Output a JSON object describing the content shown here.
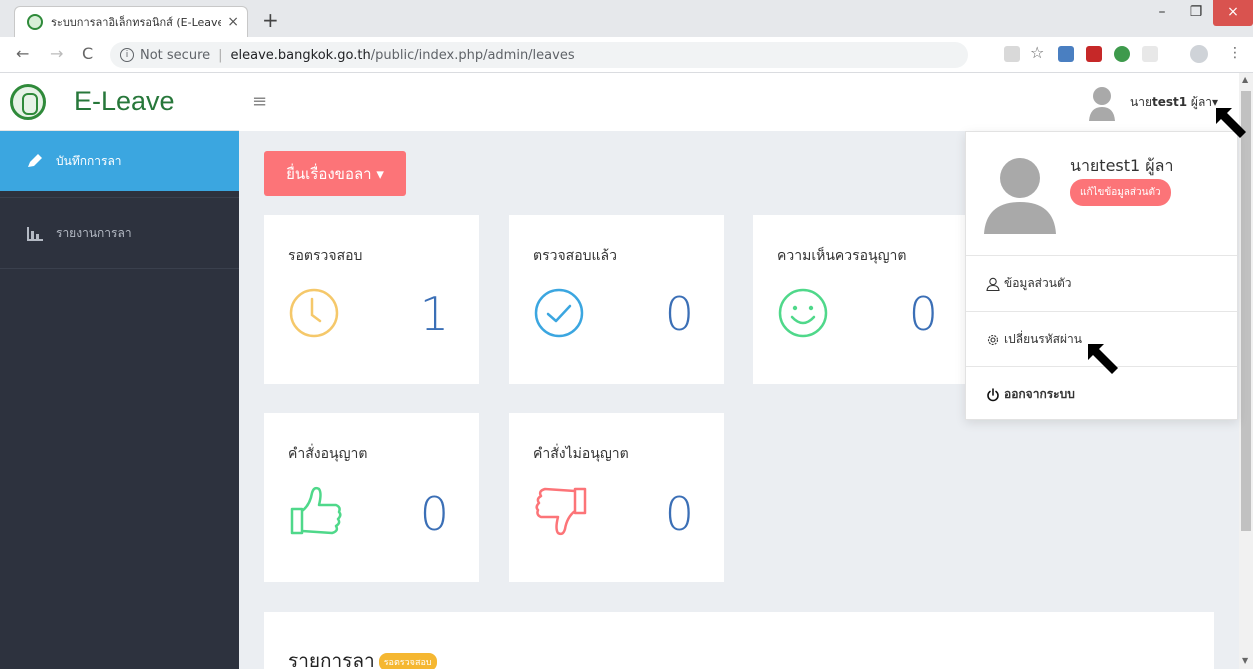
{
  "browser": {
    "tab_title": "ระบบการลาอิเล็กทรอนิกส์ (E-Leave)",
    "tab_close": "×",
    "new_tab": "+",
    "security_label": "Not secure",
    "url_host": "eleave.bangkok.go.th",
    "url_path": "/public/index.php/admin/leaves",
    "win_minimize": "–",
    "win_maximize": "❐",
    "win_close": "×"
  },
  "app": {
    "brand": "E-Leave",
    "hamburger": "≡",
    "sidebar": [
      {
        "label": "บันทึกการลา",
        "icon": "pencil-icon"
      },
      {
        "label": "รายงานการลา",
        "icon": "bar-chart-icon"
      }
    ],
    "user": {
      "prefix": "นาย",
      "name": "test1",
      "role": "ผู้ลา",
      "caret": "▾"
    },
    "request_button": "ยื่นเรื่องขอลา ▾",
    "cards": [
      {
        "title": "รอตรวจสอบ",
        "count": "1",
        "icon": "clock-icon",
        "color": "#f5c86a"
      },
      {
        "title": "ตรวจสอบแล้ว",
        "count": "0",
        "icon": "check-circle-icon",
        "color": "#3ba6e0"
      },
      {
        "title": "ความเห็นควรอนุญาต",
        "count": "0",
        "icon": "smile-icon",
        "color": "#4fd88a"
      },
      {
        "title": "คำสั่งอนุญาต",
        "count": "0",
        "icon": "thumbs-up-icon",
        "color": "#4fd88a"
      },
      {
        "title": "คำสั่งไม่อนุญาต",
        "count": "0",
        "icon": "thumbs-down-icon",
        "color": "#fc7478"
      }
    ],
    "list": {
      "title": "รายการลา",
      "badge": "รอตรวจสอบ"
    },
    "dropdown": {
      "name": "นายtest1 ผู้ลา",
      "edit_button": "แก้ไขข้อมูลส่วนตัว",
      "items": [
        {
          "label": "ข้อมูลส่วนตัว",
          "icon": "user-icon"
        },
        {
          "label": "เปลี่ยนรหัสผ่าน",
          "icon": "gear-icon"
        },
        {
          "label": "ออกจากระบบ",
          "icon": "power-icon"
        }
      ]
    }
  },
  "colors": {
    "accent_blue": "#3ba6e0",
    "danger_pink": "#fc7478",
    "sidebar_dark": "#2d323e",
    "warning_yellow": "#f5b731"
  }
}
